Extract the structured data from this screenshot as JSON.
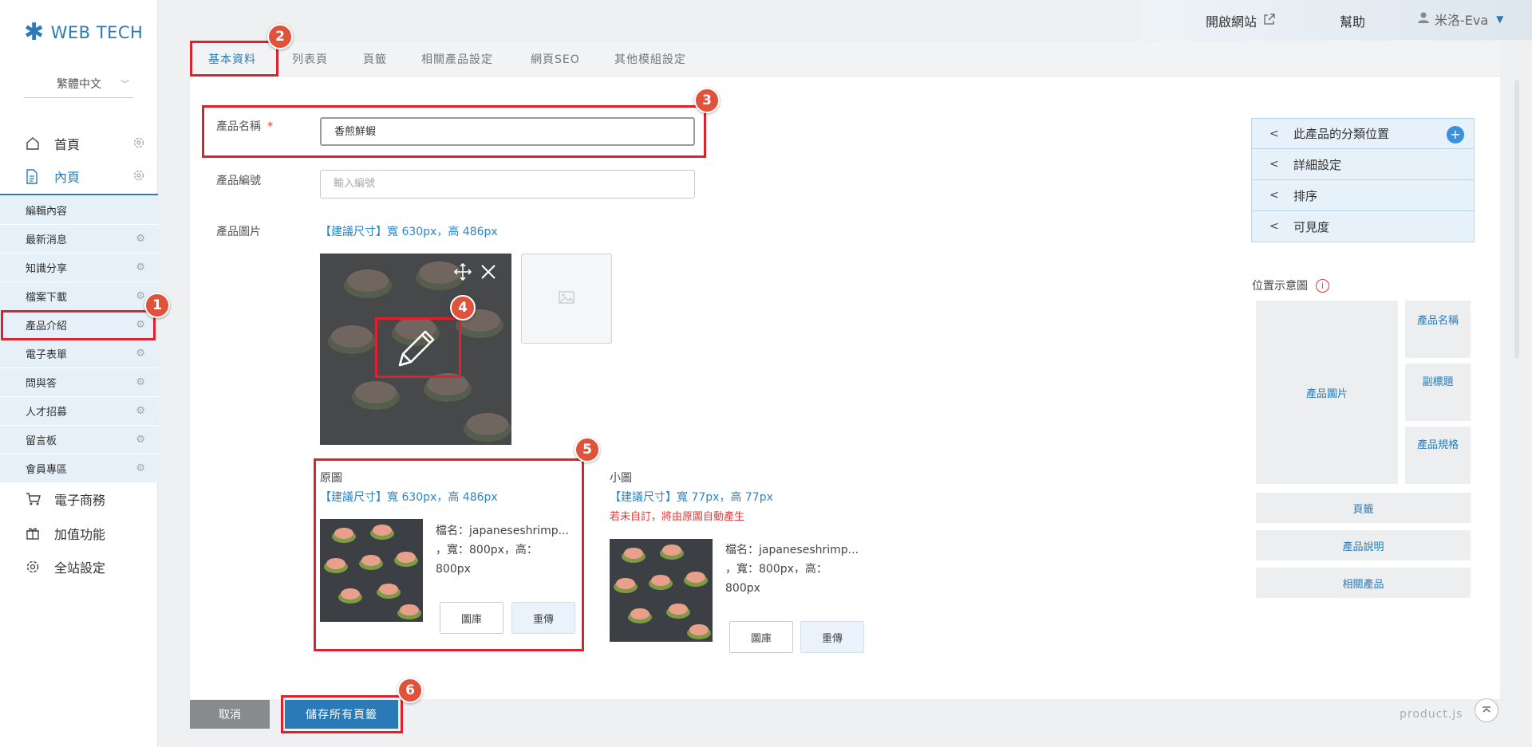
{
  "brand": {
    "logo_text": "WEB TECH",
    "accent": "#2a7ab8",
    "annotation_red": "#e0202a",
    "badge_color": "#e0523a"
  },
  "language": {
    "selected": "繁體中文"
  },
  "sidebar": {
    "top_items": [
      {
        "label": "首頁",
        "icon": "home-icon"
      },
      {
        "label": "內頁",
        "icon": "document-icon",
        "active": true
      }
    ],
    "sub_items": [
      {
        "label": "編輯內容"
      },
      {
        "label": "最新消息"
      },
      {
        "label": "知識分享"
      },
      {
        "label": "檔案下載"
      },
      {
        "label": "產品介紹",
        "highlighted": true
      },
      {
        "label": "電子表單"
      },
      {
        "label": "問與答"
      },
      {
        "label": "人才招募"
      },
      {
        "label": "留言板"
      },
      {
        "label": "會員專區"
      }
    ],
    "bottom_items": [
      {
        "label": "電子商務",
        "icon": "cart-icon"
      },
      {
        "label": "加值功能",
        "icon": "gift-icon"
      },
      {
        "label": "全站設定",
        "icon": "gear-icon"
      }
    ]
  },
  "topbar": {
    "open_site": "開啟網站",
    "help": "幫助",
    "user": "米洛-Eva"
  },
  "tabs": [
    "基本資料",
    "列表頁",
    "頁籤",
    "相關產品設定",
    "網頁SEO",
    "其他模組設定"
  ],
  "form": {
    "name_label": "產品名稱",
    "name_required": "*",
    "name_value": "香煎鮮蝦",
    "code_label": "產品編號",
    "code_placeholder": "輸入編號",
    "image_label": "產品圖片",
    "image_hint": "【建議尺寸】寬 630px，高 486px"
  },
  "original": {
    "title": "原圖",
    "hint": "【建議尺寸】寬 630px，高 486px",
    "file_line1": "檔名：japaneseshrimp...",
    "file_line2": "，寬：800px，高：",
    "file_line3": "800px",
    "library_button": "圖庫",
    "reupload_button": "重傳"
  },
  "small": {
    "title": "小圖",
    "hint": "【建議尺寸】寬 77px，高 77px",
    "warning": "若未自訂，將由原圖自動產生",
    "file_line1": "檔名：japaneseshrimp...",
    "file_line2": "，寬：800px，高：",
    "file_line3": "800px",
    "library_button": "圖庫",
    "reupload_button": "重傳"
  },
  "right_panel": {
    "accordions": [
      "此產品的分類位置",
      "詳細設定",
      "排序",
      "可見度"
    ],
    "position_title": "位置示意圖",
    "position_boxes": {
      "image": "產品圖片",
      "name": "產品名稱",
      "subtitle": "副標題",
      "spec": "產品規格",
      "tabs": "頁籤",
      "description": "產品說明",
      "related": "相關產品"
    }
  },
  "bottom": {
    "cancel": "取消",
    "save_all": "儲存所有頁籤",
    "file_tag": "product.js"
  },
  "annotations": [
    "1",
    "2",
    "3",
    "4",
    "5",
    "6"
  ]
}
